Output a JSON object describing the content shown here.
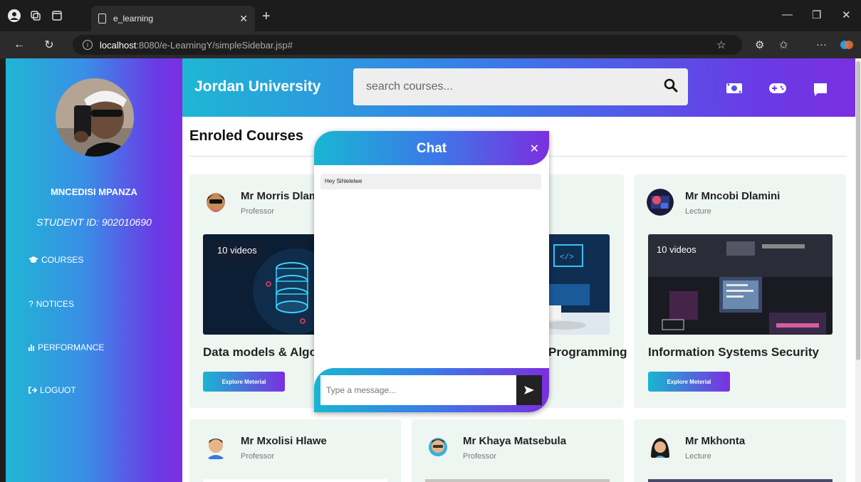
{
  "browser": {
    "tab_title": "e_learning",
    "url_host": "localhost",
    "url_rest": ":8080/e-LearningY/simpleSidebar.jsp#"
  },
  "sidebar": {
    "student_name": "MNCEDISI MPANZA",
    "student_id": "STUDENT ID: 902010690",
    "items": [
      {
        "label": "COURSES",
        "icon": "graduation-cap-icon"
      },
      {
        "label": "NOTICES",
        "icon": "question-icon"
      },
      {
        "label": "PERFORMANCE",
        "icon": "bar-chart-icon"
      },
      {
        "label": "LOGUOT",
        "icon": "sign-out-icon"
      }
    ]
  },
  "header": {
    "brand": "Jordan University",
    "search_placeholder": "search courses..."
  },
  "content": {
    "title": "Enroled Courses"
  },
  "courses": [
    {
      "prof": "Mr Morris Dlamini",
      "role": "Professor",
      "videos": "10 videos",
      "title": "Data models & Algorithms",
      "button": "Explore Meterial"
    },
    {
      "prof": "",
      "role": "",
      "videos": "",
      "title": "Programming",
      "button": ""
    },
    {
      "prof": "Mr Mncobi Dlamini",
      "role": "Lecture",
      "videos": "10 videos",
      "title": "Information Systems Security",
      "button": "Explore Meterial"
    },
    {
      "prof": "Mr Mxolisi Hlawe",
      "role": "Professor"
    },
    {
      "prof": "Mr Khaya Matsebula",
      "role": "Professor"
    },
    {
      "prof": "Mr Mkhonta",
      "role": "Lecture"
    }
  ],
  "chat": {
    "title": "Chat",
    "message": "Hey Sihlelelwe",
    "input_placeholder": "Type a message..."
  },
  "colors": {
    "gradient_start": "#1fb6d4",
    "gradient_end": "#7b2fe0",
    "card_bg": "#eef6f2"
  }
}
